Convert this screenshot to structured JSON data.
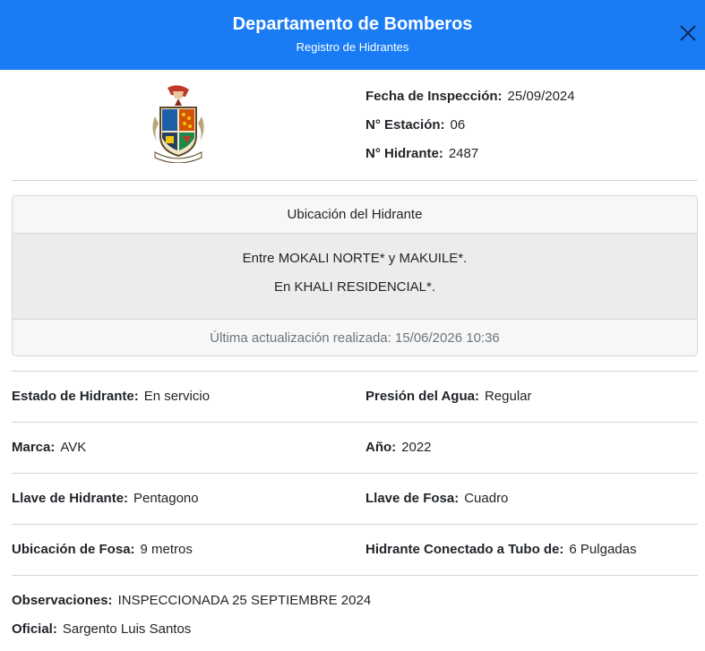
{
  "header": {
    "title": "Departamento de Bomberos",
    "subtitle": "Registro de Hidrantes"
  },
  "meta": {
    "fecha_label": "Fecha de Inspección:",
    "fecha_value": "25/09/2024",
    "estacion_label": "N° Estación:",
    "estacion_value": "06",
    "hidrante_label": "N° Hidrante:",
    "hidrante_value": "2487"
  },
  "ubicacion": {
    "title": "Ubicación del Hidrante",
    "line1": "Entre MOKALI NORTE* y MAKUILE*.",
    "line2": "En KHALI RESIDENCIAL*.",
    "footer": "Última actualización realizada: 15/06/2026 10:36"
  },
  "details": {
    "estado_label": "Estado de Hidrante:",
    "estado_value": "En servicio",
    "presion_label": "Presión del Agua:",
    "presion_value": "Regular",
    "marca_label": "Marca:",
    "marca_value": "AVK",
    "anio_label": "Año:",
    "anio_value": "2022",
    "llave_hidrante_label": "Llave de Hidrante:",
    "llave_hidrante_value": "Pentagono",
    "llave_fosa_label": "Llave de Fosa:",
    "llave_fosa_value": "Cuadro",
    "ubicacion_fosa_label": "Ubicación de Fosa:",
    "ubicacion_fosa_value": "9 metros",
    "tubo_label": "Hidrante Conectado a Tubo de:",
    "tubo_value": "6 Pulgadas"
  },
  "observaciones": {
    "label": "Observaciones:",
    "value": "INSPECCIONADA 25 SEPTIEMBRE 2024"
  },
  "oficial": {
    "label": "Oficial:",
    "value": "Sargento Luis Santos"
  },
  "colors": {
    "header_bg": "#1a7cf5",
    "card_body_bg": "#ececec"
  }
}
